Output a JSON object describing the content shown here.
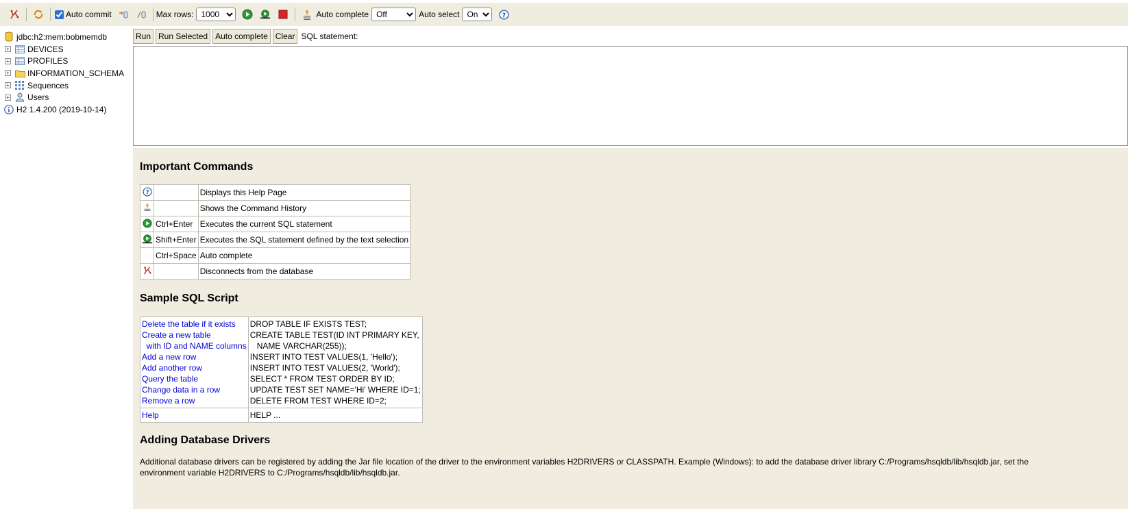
{
  "toolbar": {
    "auto_commit_label": "Auto commit",
    "auto_commit_checked": true,
    "max_rows_label": "Max rows:",
    "max_rows_value": "1000",
    "auto_complete_label": "Auto complete",
    "auto_complete_value": "Off",
    "auto_select_label": "Auto select",
    "auto_select_value": "On"
  },
  "tree": {
    "connection": "jdbc:h2:mem:bobmemdb",
    "items": [
      {
        "label": "DEVICES",
        "icon": "table-icon"
      },
      {
        "label": "PROFILES",
        "icon": "table-icon"
      },
      {
        "label": "INFORMATION_SCHEMA",
        "icon": "folder-icon"
      },
      {
        "label": "Sequences",
        "icon": "sequences-icon"
      },
      {
        "label": "Users",
        "icon": "users-icon"
      }
    ],
    "version": "H2 1.4.200 (2019-10-14)"
  },
  "sql": {
    "run_label": "Run",
    "run_selected_label": "Run Selected",
    "auto_complete_label": "Auto complete",
    "clear_label": "Clear",
    "statement_label": "SQL statement:",
    "statement_value": ""
  },
  "help": {
    "important_title": "Important Commands",
    "commands": [
      {
        "icon": "help-icon",
        "key": "",
        "desc": "Displays this Help Page"
      },
      {
        "icon": "history-icon",
        "key": "",
        "desc": "Shows the Command History"
      },
      {
        "icon": "run-icon",
        "key": "Ctrl+Enter",
        "desc": "Executes the current SQL statement"
      },
      {
        "icon": "run-selected-icon",
        "key": "Shift+Enter",
        "desc": "Executes the SQL statement defined by the text selection"
      },
      {
        "icon": "",
        "key": "Ctrl+Space",
        "desc": "Auto complete"
      },
      {
        "icon": "disconnect-icon",
        "key": "",
        "desc": "Disconnects from the database"
      }
    ],
    "sample_title": "Sample SQL Script",
    "sample_rows": [
      {
        "link": "Delete the table if it exists",
        "sql": "DROP TABLE IF EXISTS TEST;"
      },
      {
        "link": "Create a new table",
        "sql": "CREATE TABLE TEST(ID INT PRIMARY KEY,"
      },
      {
        "link": "  with ID and NAME columns",
        "sql": "   NAME VARCHAR(255));"
      },
      {
        "link": "Add a new row",
        "sql": "INSERT INTO TEST VALUES(1, 'Hello');"
      },
      {
        "link": "Add another row",
        "sql": "INSERT INTO TEST VALUES(2, 'World');"
      },
      {
        "link": "Query the table",
        "sql": "SELECT * FROM TEST ORDER BY ID;"
      },
      {
        "link": "Change data in a row",
        "sql": "UPDATE TEST SET NAME='Hi' WHERE ID=1;"
      },
      {
        "link": "Remove a row",
        "sql": "DELETE FROM TEST WHERE ID=2;"
      }
    ],
    "help_row": {
      "link": "Help",
      "sql": "HELP ..."
    },
    "drivers_title": "Adding Database Drivers",
    "drivers_text": "Additional database drivers can be registered by adding the Jar file location of the driver to the environment variables H2DRIVERS or CLASSPATH. Example (Windows): to add the database driver library C:/Programs/hsqldb/lib/hsqldb.jar, set the environment variable H2DRIVERS to C:/Programs/hsqldb/lib/hsqldb.jar."
  }
}
